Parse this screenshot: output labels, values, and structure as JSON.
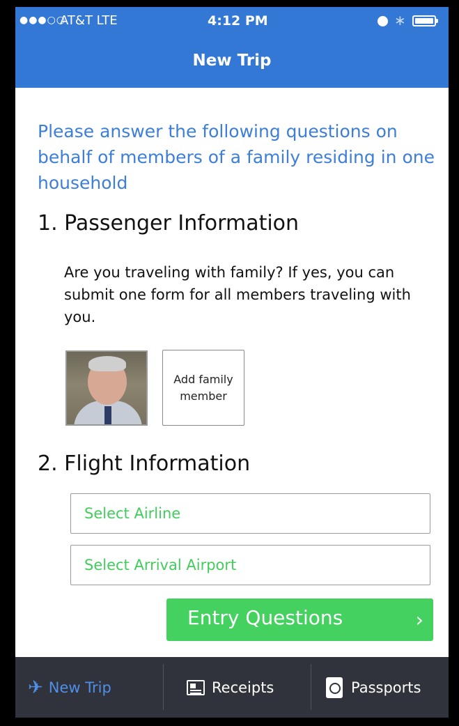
{
  "status_bar": {
    "signal": "●●●○○",
    "carrier": "AT&T  LTE",
    "time": "4:12 PM"
  },
  "header": {
    "title": "New Trip"
  },
  "intro": "Please answer the following questions on behalf of members of a family residing in one household",
  "passenger": {
    "title": "1. Passenger Information",
    "description": "Are you traveling with family? If yes, you can submit one form for all members traveling with you.",
    "add_member_label": "Add family member"
  },
  "flight": {
    "title": "2. Flight Information",
    "airline_placeholder": "Select Airline",
    "airport_placeholder": "Select Arrival Airport"
  },
  "entry_button": {
    "label": "Entry Questions",
    "chevron": "›"
  },
  "tabbar": {
    "items": [
      {
        "label": "New Trip",
        "icon": "plane-icon"
      },
      {
        "label": "Receipts",
        "icon": "receipt-icon"
      },
      {
        "label": "Passports",
        "icon": "passport-icon"
      }
    ]
  },
  "colors": {
    "header": "#3478d6",
    "intro_text": "#3d7fd8",
    "accent_green": "#44d15f",
    "tabbar": "#30323c",
    "active_tab": "#4f8fe6"
  }
}
